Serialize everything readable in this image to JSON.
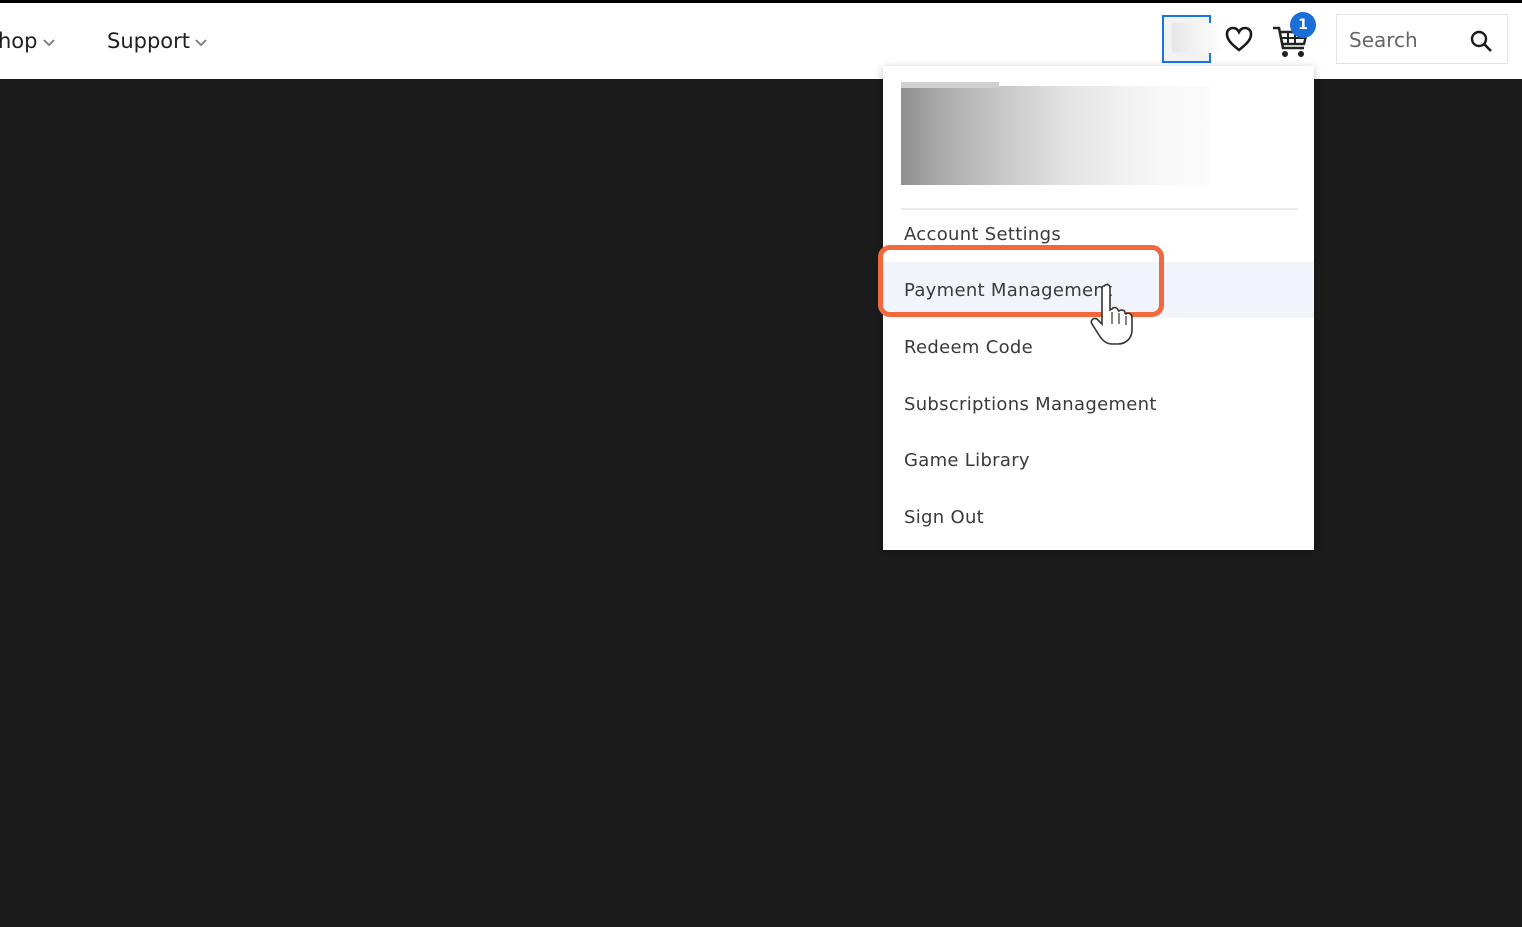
{
  "nav": {
    "items": [
      {
        "label": "hop"
      },
      {
        "label": "Support"
      }
    ]
  },
  "header": {
    "cart_count": "1",
    "search_placeholder": "Search"
  },
  "account_menu": {
    "items": [
      {
        "label": "Account Settings"
      },
      {
        "label": "Payment Management"
      },
      {
        "label": "Redeem Code"
      },
      {
        "label": "Subscriptions Management"
      },
      {
        "label": "Game Library"
      },
      {
        "label": "Sign Out"
      }
    ],
    "hovered_index": 1
  },
  "colors": {
    "accent": "#1a73e8",
    "badge": "#1a6ed8",
    "highlight": "#f0683c",
    "background": "#1b1b1b"
  }
}
